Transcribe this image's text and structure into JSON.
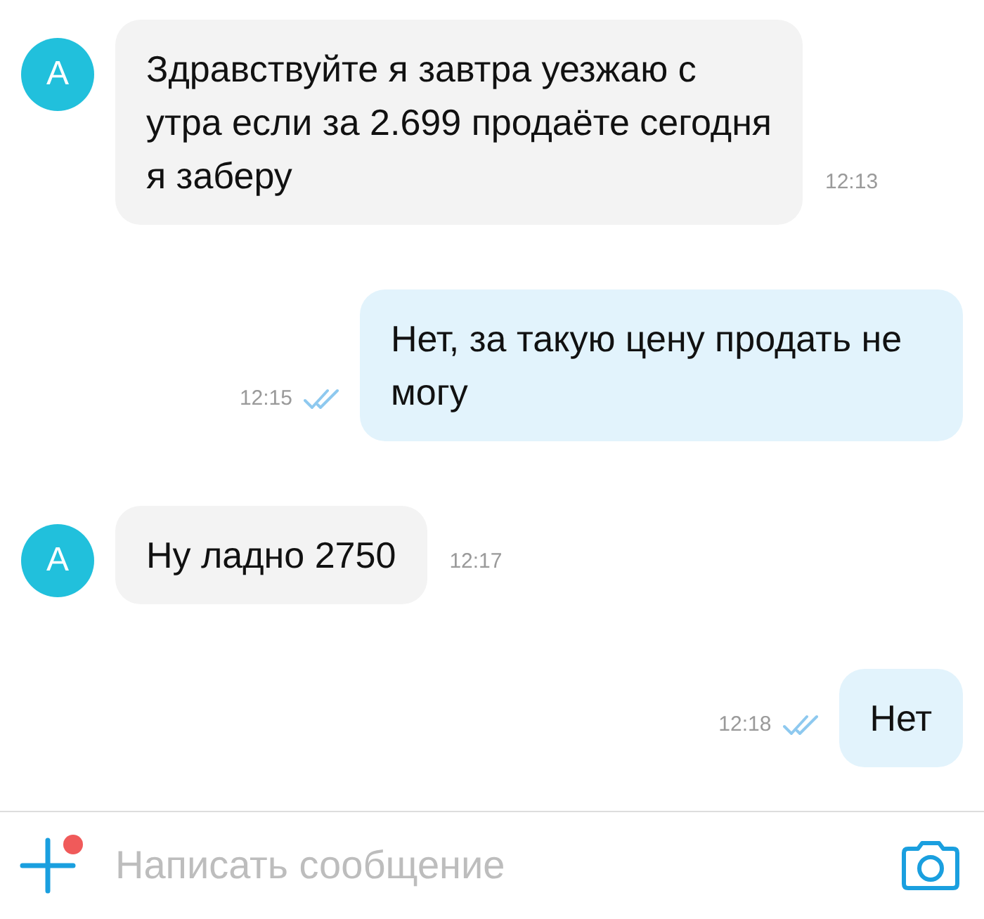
{
  "messages": [
    {
      "kind": "incoming",
      "avatar": "A",
      "text": "Здравствуйте я завтра уезжаю с утра если за 2.699 продаёте сегодня я заберу",
      "time": "12:13"
    },
    {
      "kind": "outgoing",
      "text": "Нет, за такую цену продать не могу",
      "time": "12:15",
      "read": true
    },
    {
      "kind": "incoming",
      "avatar": "A",
      "text": "Ну ладно 2750",
      "time": "12:17"
    },
    {
      "kind": "outgoing",
      "text": "Нет",
      "time": "12:18",
      "read": true
    }
  ],
  "composer": {
    "placeholder": "Написать сообщение"
  }
}
